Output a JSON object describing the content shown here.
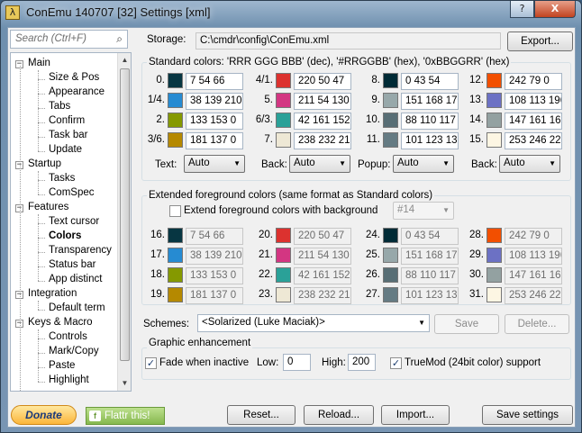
{
  "window": {
    "title": "ConEmu 140707 [32] Settings [xml]",
    "icon_glyph": "λ",
    "minimize_glyph": "?",
    "close_glyph": "X"
  },
  "search": {
    "placeholder": "Search (Ctrl+F)",
    "icon": "search-icon"
  },
  "tree": [
    {
      "label": "Main",
      "level": 0,
      "expanded": true
    },
    {
      "label": "Size & Pos",
      "level": 1
    },
    {
      "label": "Appearance",
      "level": 1
    },
    {
      "label": "Tabs",
      "level": 1
    },
    {
      "label": "Confirm",
      "level": 1
    },
    {
      "label": "Task bar",
      "level": 1
    },
    {
      "label": "Update",
      "level": 1
    },
    {
      "label": "Startup",
      "level": 0,
      "expanded": true
    },
    {
      "label": "Tasks",
      "level": 1
    },
    {
      "label": "ComSpec",
      "level": 1
    },
    {
      "label": "Features",
      "level": 0,
      "expanded": true
    },
    {
      "label": "Text cursor",
      "level": 1
    },
    {
      "label": "Colors",
      "level": 1,
      "selected": true
    },
    {
      "label": "Transparency",
      "level": 1
    },
    {
      "label": "Status bar",
      "level": 1
    },
    {
      "label": "App distinct",
      "level": 1
    },
    {
      "label": "Integration",
      "level": 0,
      "expanded": true
    },
    {
      "label": "Default term",
      "level": 1
    },
    {
      "label": "Keys & Macro",
      "level": 0,
      "expanded": true
    },
    {
      "label": "Controls",
      "level": 1
    },
    {
      "label": "Mark/Copy",
      "level": 1
    },
    {
      "label": "Paste",
      "level": 1
    },
    {
      "label": "Highlight",
      "level": 1
    }
  ],
  "storage": {
    "label": "Storage:",
    "value": "C:\\cmdr\\config\\ConEmu.xml",
    "export_label": "Export..."
  },
  "standard": {
    "title": "Standard colors: 'RRR GGG BBB' (dec), '#RRGGBB' (hex), '0xBBGGRR' (hex)",
    "colors": [
      {
        "idx": "0.",
        "value": "7 54 66",
        "hex": "#073642"
      },
      {
        "idx": "1/4.",
        "value": "38 139 210",
        "hex": "#268bd2"
      },
      {
        "idx": "2.",
        "value": "133 153 0",
        "hex": "#859900"
      },
      {
        "idx": "3/6.",
        "value": "181 137 0",
        "hex": "#b58900"
      },
      {
        "idx": "4/1.",
        "value": "220 50 47",
        "hex": "#dc322f"
      },
      {
        "idx": "5.",
        "value": "211 54 130",
        "hex": "#d33682"
      },
      {
        "idx": "6/3.",
        "value": "42 161 152",
        "hex": "#2aa198"
      },
      {
        "idx": "7.",
        "value": "238 232 213",
        "hex": "#eee8d5"
      },
      {
        "idx": "8.",
        "value": "0 43 54",
        "hex": "#002b36"
      },
      {
        "idx": "9.",
        "value": "151 168 170",
        "hex": "#97a8aa"
      },
      {
        "idx": "10.",
        "value": "88 110 117",
        "hex": "#586e75"
      },
      {
        "idx": "11.",
        "value": "101 123 131",
        "hex": "#657b83"
      },
      {
        "idx": "12.",
        "value": "242 79 0",
        "hex": "#f24f00"
      },
      {
        "idx": "13.",
        "value": "108 113 196",
        "hex": "#6c71c4"
      },
      {
        "idx": "14.",
        "value": "147 161 161",
        "hex": "#93a1a1"
      },
      {
        "idx": "15.",
        "value": "253 246 227",
        "hex": "#fdf6e3"
      }
    ],
    "text_label": "Text:",
    "text_value": "Auto",
    "back_label": "Back:",
    "back_value": "Auto",
    "popup_label": "Popup:",
    "popup_value": "Auto",
    "back2_label": "Back:",
    "back2_value": "Auto"
  },
  "extended": {
    "title": "Extended foreground colors (same format as Standard colors)",
    "checkbox_label": "Extend foreground colors with background",
    "checkbox_checked": false,
    "combo_value": "#14",
    "colors": [
      {
        "idx": "16.",
        "value": "7 54 66",
        "hex": "#073642"
      },
      {
        "idx": "17.",
        "value": "38 139 210",
        "hex": "#268bd2"
      },
      {
        "idx": "18.",
        "value": "133 153 0",
        "hex": "#859900"
      },
      {
        "idx": "19.",
        "value": "181 137 0",
        "hex": "#b58900"
      },
      {
        "idx": "20.",
        "value": "220 50 47",
        "hex": "#dc322f"
      },
      {
        "idx": "21.",
        "value": "211 54 130",
        "hex": "#d33682"
      },
      {
        "idx": "22.",
        "value": "42 161 152",
        "hex": "#2aa198"
      },
      {
        "idx": "23.",
        "value": "238 232 213",
        "hex": "#eee8d5"
      },
      {
        "idx": "24.",
        "value": "0 43 54",
        "hex": "#002b36"
      },
      {
        "idx": "25.",
        "value": "151 168 170",
        "hex": "#97a8aa"
      },
      {
        "idx": "26.",
        "value": "88 110 117",
        "hex": "#586e75"
      },
      {
        "idx": "27.",
        "value": "101 123 131",
        "hex": "#657b83"
      },
      {
        "idx": "28.",
        "value": "242 79 0",
        "hex": "#f24f00"
      },
      {
        "idx": "29.",
        "value": "108 113 196",
        "hex": "#6c71c4"
      },
      {
        "idx": "30.",
        "value": "147 161 161",
        "hex": "#93a1a1"
      },
      {
        "idx": "31.",
        "value": "253 246 227",
        "hex": "#fdf6e3"
      }
    ]
  },
  "schemes": {
    "label": "Schemes:",
    "value": "<Solarized (Luke Maciak)>",
    "save_label": "Save",
    "delete_label": "Delete..."
  },
  "graphic": {
    "title": "Graphic enhancement",
    "fade_label": "Fade when inactive",
    "fade_checked": true,
    "low_label": "Low:",
    "low_value": "0",
    "high_label": "High:",
    "high_value": "200",
    "truemod_label": "TrueMod (24bit color) support",
    "truemod_checked": true
  },
  "footer": {
    "donate_label": "Donate",
    "flattr_label": "Flattr this!",
    "reset_label": "Reset...",
    "reload_label": "Reload...",
    "import_label": "Import...",
    "save_label": "Save settings"
  }
}
